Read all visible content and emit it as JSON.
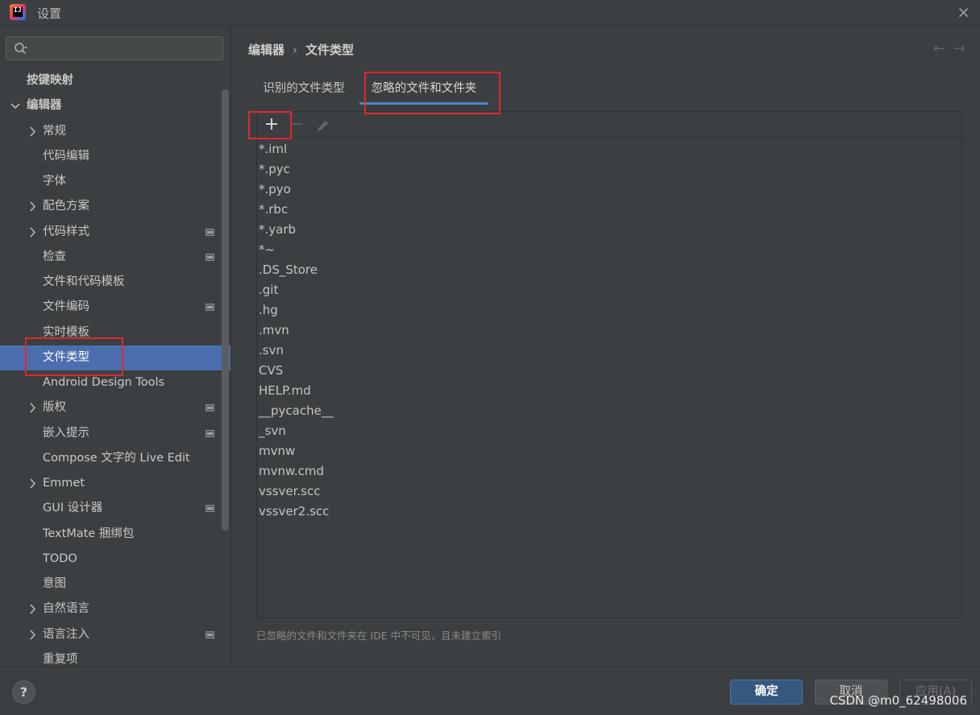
{
  "window": {
    "title": "设置",
    "close_glyph": "×"
  },
  "search": {
    "placeholder": ""
  },
  "sidebar": {
    "items": [
      {
        "label": "按键映射",
        "level": 0,
        "expander": "none",
        "badge": false,
        "selected": false,
        "bold": true
      },
      {
        "label": "编辑器",
        "level": 0,
        "expander": "expanded",
        "badge": false,
        "selected": false,
        "bold": true
      },
      {
        "label": "常规",
        "level": 1,
        "expander": "collapsed",
        "badge": false,
        "selected": false
      },
      {
        "label": "代码编辑",
        "level": 1,
        "expander": "none",
        "badge": false,
        "selected": false
      },
      {
        "label": "字体",
        "level": 1,
        "expander": "none",
        "badge": false,
        "selected": false
      },
      {
        "label": "配色方案",
        "level": 1,
        "expander": "collapsed",
        "badge": false,
        "selected": false
      },
      {
        "label": "代码样式",
        "level": 1,
        "expander": "collapsed",
        "badge": true,
        "selected": false
      },
      {
        "label": "检查",
        "level": 1,
        "expander": "none",
        "badge": true,
        "selected": false
      },
      {
        "label": "文件和代码模板",
        "level": 1,
        "expander": "none",
        "badge": false,
        "selected": false
      },
      {
        "label": "文件编码",
        "level": 1,
        "expander": "none",
        "badge": true,
        "selected": false
      },
      {
        "label": "实时模板",
        "level": 1,
        "expander": "none",
        "badge": false,
        "selected": false
      },
      {
        "label": "文件类型",
        "level": 1,
        "expander": "none",
        "badge": false,
        "selected": true
      },
      {
        "label": "Android Design Tools",
        "level": 1,
        "expander": "none",
        "badge": false,
        "selected": false
      },
      {
        "label": "版权",
        "level": 1,
        "expander": "collapsed",
        "badge": true,
        "selected": false
      },
      {
        "label": "嵌入提示",
        "level": 1,
        "expander": "none",
        "badge": true,
        "selected": false
      },
      {
        "label": "Compose 文字的 Live Edit",
        "level": 1,
        "expander": "none",
        "badge": false,
        "selected": false
      },
      {
        "label": "Emmet",
        "level": 1,
        "expander": "collapsed",
        "badge": false,
        "selected": false
      },
      {
        "label": "GUI 设计器",
        "level": 1,
        "expander": "none",
        "badge": true,
        "selected": false
      },
      {
        "label": "TextMate 捆绑包",
        "level": 1,
        "expander": "none",
        "badge": false,
        "selected": false
      },
      {
        "label": "TODO",
        "level": 1,
        "expander": "none",
        "badge": false,
        "selected": false
      },
      {
        "label": "意图",
        "level": 1,
        "expander": "none",
        "badge": false,
        "selected": false
      },
      {
        "label": "自然语言",
        "level": 1,
        "expander": "collapsed",
        "badge": false,
        "selected": false
      },
      {
        "label": "语言注入",
        "level": 1,
        "expander": "collapsed",
        "badge": true,
        "selected": false
      },
      {
        "label": "重复项",
        "level": 1,
        "expander": "none",
        "badge": false,
        "selected": false
      }
    ]
  },
  "breadcrumb": {
    "parent": "编辑器",
    "separator": "›",
    "current": "文件类型"
  },
  "nav": {
    "back": "←",
    "forward": "→"
  },
  "tabs": [
    {
      "label": "识别的文件类型",
      "active": false
    },
    {
      "label": "忽略的文件和文件夹",
      "active": true
    }
  ],
  "toolbar": {
    "add": "+",
    "remove": "−",
    "edit_icon": "pencil-icon"
  },
  "ignored_list": [
    "*.iml",
    "*.pyc",
    "*.pyo",
    "*.rbc",
    "*.yarb",
    "*~",
    ".DS_Store",
    ".git",
    ".hg",
    ".mvn",
    ".svn",
    "CVS",
    "HELP.md",
    "__pycache__",
    "_svn",
    "mvnw",
    "mvnw.cmd",
    "vssver.scc",
    "vssver2.scc"
  ],
  "hint": "已忽略的文件和文件夹在 IDE 中不可见，且未建立索引",
  "footer": {
    "help": "?",
    "ok": "确定",
    "cancel": "取消",
    "apply": "应用(A)",
    "watermark": "CSDN @m0_62498006"
  },
  "colors": {
    "accent": "#4b6eaf",
    "tab_underline": "#4a88c7",
    "highlight_box": "#e0282e",
    "primary_button": "#365880"
  }
}
